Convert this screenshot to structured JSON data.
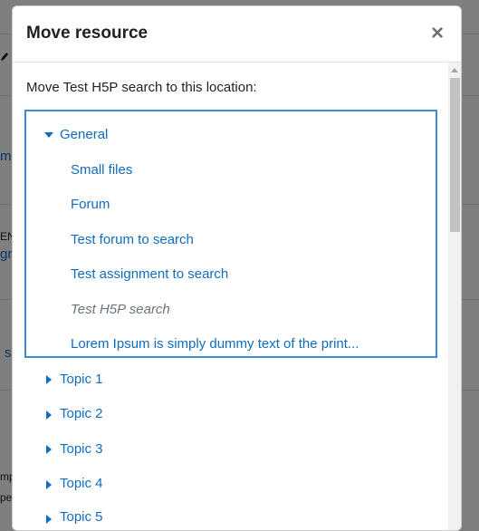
{
  "background": {
    "fragments": [
      "m",
      "EN",
      "gr",
      "s",
      "mp",
      "pe"
    ]
  },
  "modal": {
    "title": "Move resource",
    "close_glyph": "×",
    "intro": "Move Test H5P search to this location:"
  },
  "tree": {
    "section": {
      "label": "General",
      "icon": "caret-down-icon"
    },
    "activities": [
      {
        "label": "Small files",
        "current": false
      },
      {
        "label": "Forum",
        "current": false
      },
      {
        "label": "Test forum to search",
        "current": false
      },
      {
        "label": "Test assignment to search",
        "current": false
      },
      {
        "label": "Test H5P search",
        "current": true
      },
      {
        "label": "Lorem Ipsum is simply dummy text of the print...",
        "current": false
      }
    ],
    "topics": [
      {
        "label": "Topic 1",
        "icon": "caret-right-icon"
      },
      {
        "label": "Topic 2",
        "icon": "caret-right-icon"
      },
      {
        "label": "Topic 3",
        "icon": "caret-right-icon"
      },
      {
        "label": "Topic 4",
        "icon": "caret-right-icon"
      },
      {
        "label": "Topic 5",
        "icon": "caret-right-icon"
      }
    ]
  },
  "colors": {
    "link": "#0f6cbf",
    "focus_border": "#3b8ad3",
    "muted": "#6a737b"
  }
}
